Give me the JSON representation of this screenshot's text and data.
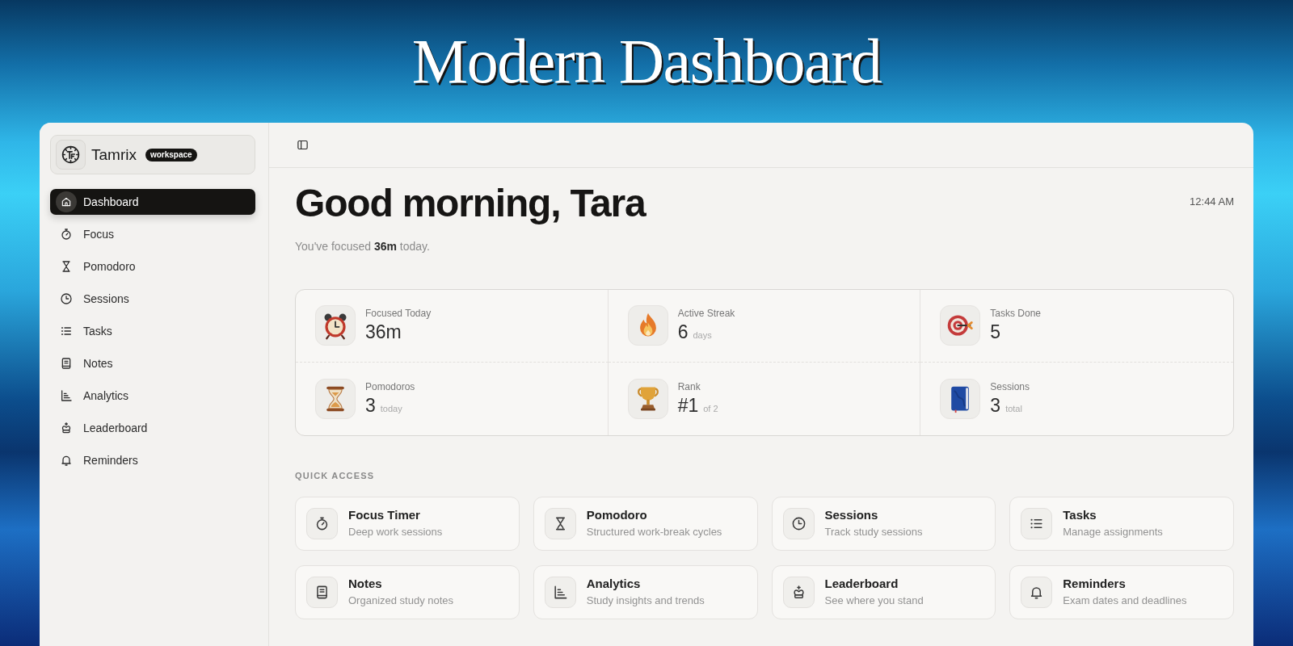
{
  "page_title": "Modern Dashboard",
  "sidebar": {
    "brand": {
      "name": "Tamrix",
      "badge": "workspace"
    },
    "items": [
      {
        "label": "Dashboard",
        "selected": true
      },
      {
        "label": "Focus",
        "selected": false
      },
      {
        "label": "Pomodoro",
        "selected": false
      },
      {
        "label": "Sessions",
        "selected": false
      },
      {
        "label": "Tasks",
        "selected": false
      },
      {
        "label": "Notes",
        "selected": false
      },
      {
        "label": "Analytics",
        "selected": false
      },
      {
        "label": "Leaderboard",
        "selected": false
      },
      {
        "label": "Reminders",
        "selected": false
      }
    ]
  },
  "header": {
    "greeting": "Good morning, Tara",
    "time": "12:44 AM",
    "summary": "You've focused **36m** today."
  },
  "stats": [
    {
      "label": "Focused Today",
      "value": "36m"
    },
    {
      "label": "Active Streak",
      "value": "6",
      "unit": "days"
    },
    {
      "label": "Tasks Done",
      "value": "5"
    },
    {
      "label": "Pomodoros",
      "value": "3",
      "unit": "today"
    },
    {
      "label": "Rank",
      "value": "#1",
      "unit": "of 2"
    },
    {
      "label": "Sessions",
      "value": "3",
      "unit": "total"
    }
  ],
  "quick_access": {
    "title": "QUICK ACCESS",
    "cards": [
      {
        "title": "Focus Timer",
        "description": "Deep work sessions"
      },
      {
        "title": "Pomodoro",
        "description": "Structured work-break cycles"
      },
      {
        "title": "Sessions",
        "description": "Track study sessions"
      },
      {
        "title": "Tasks",
        "description": "Manage assignments"
      },
      {
        "title": "Notes",
        "description": "Organized study notes"
      },
      {
        "title": "Analytics",
        "description": "Study insights and trends"
      },
      {
        "title": "Leaderboard",
        "description": "See where you stand"
      },
      {
        "title": "Reminders",
        "description": "Exam dates and deadlines"
      }
    ]
  }
}
